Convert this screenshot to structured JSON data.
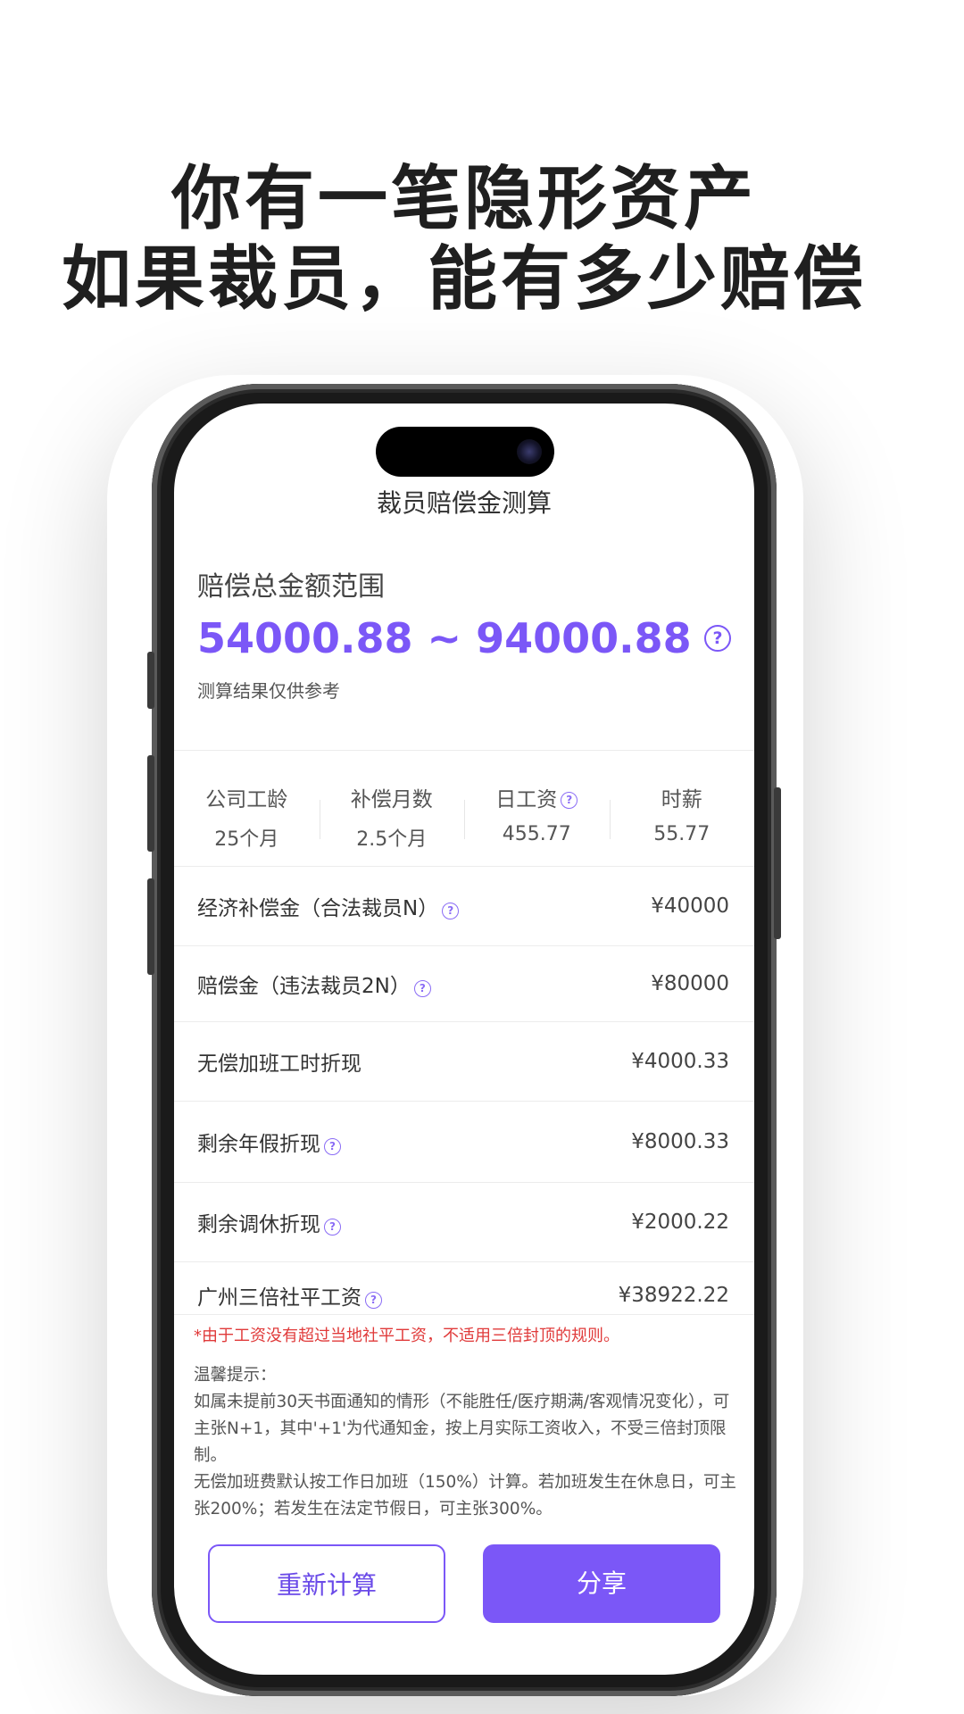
{
  "headline": {
    "line1": "你有一笔隐形资产",
    "line2": "如果裁员，能有多少赔偿"
  },
  "app": {
    "nav_title": "裁员赔偿金测算",
    "total": {
      "label": "赔偿总金额范围",
      "range": "54000.88 ~ 94000.88",
      "note": "测算结果仅供参考",
      "help_icon": "?"
    },
    "stats": [
      {
        "label": "公司工龄",
        "value": "25个月"
      },
      {
        "label": "补偿月数",
        "value": "2.5个月"
      },
      {
        "label": "日工资",
        "value": "455.77",
        "has_help": true
      },
      {
        "label": "时薪",
        "value": "55.77"
      }
    ],
    "rows": [
      {
        "label": "经济补偿金（合法裁员N）",
        "value": "¥40000",
        "has_help": true
      },
      {
        "label": "赔偿金（违法裁员2N）",
        "value": "¥80000",
        "has_help": true
      },
      {
        "label": "无偿加班工时折现",
        "value": "¥4000.33",
        "has_help": false
      },
      {
        "label": "剩余年假折现",
        "value": "¥8000.33",
        "has_help": true
      },
      {
        "label": "剩余调休折现",
        "value": "¥2000.22",
        "has_help": true
      },
      {
        "label": "广州三倍社平工资",
        "value": "¥38922.22",
        "has_help": true
      }
    ],
    "warning": "*由于工资没有超过当地社平工资，不适用三倍封顶的规则。",
    "tips": {
      "title": "温馨提示：",
      "p1": "如属未提前30天书面通知的情形（不能胜任/医疗期满/客观情况变化），可主张N+1，其中'+1'为代通知金，按上月实际工资收入，不受三倍封顶限制。",
      "p2": "无偿加班费默认按工作日加班（150%）计算。若加班发生在休息日，可主张200%；若发生在法定节假日，可主张300%。"
    },
    "buttons": {
      "recalc": "重新计算",
      "share": "分享"
    },
    "colors": {
      "accent": "#7b57f7",
      "warning": "#e03a3a"
    }
  }
}
